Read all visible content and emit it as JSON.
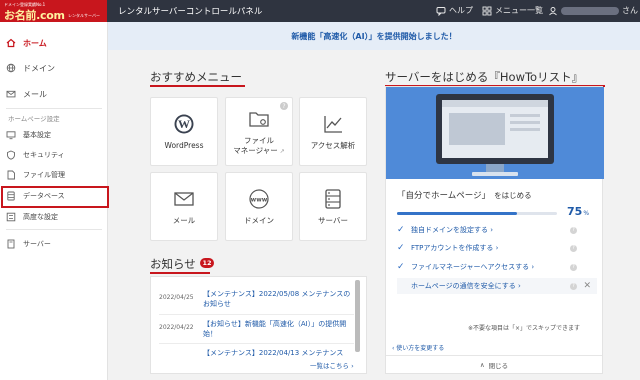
{
  "header": {
    "logo_tagline": "ドメイン登録実績No.1",
    "logo_brand": "お名前.com",
    "logo_sub": "レンタルサーバー",
    "title": "レンタルサーバーコントロールパネル",
    "help_label": "ヘルプ",
    "menu_label": "メニュー一覧",
    "user_suffix": "さん"
  },
  "notice": {
    "text": "新機能「高速化（AI）」を提供開始しました！"
  },
  "sidebar": {
    "home": "ホーム",
    "domain": "ドメイン",
    "mail": "メール",
    "section_label": "ホームページ設定",
    "basic": "基本設定",
    "security": "セキュリティ",
    "file_manager": "ファイル管理",
    "database": "データベース",
    "advanced": "高度な設定",
    "server": "サーバー"
  },
  "recommended": {
    "title": "おすすめメニュー",
    "cards": [
      {
        "label": "WordPress",
        "icon": "wordpress-icon"
      },
      {
        "label": "ファイル",
        "label2": "マネージャー",
        "icon": "folder-gear-icon",
        "help": "?",
        "ext": "↗"
      },
      {
        "label": "アクセス解析",
        "icon": "chart-line-icon"
      },
      {
        "label": "メール",
        "icon": "envelope-icon"
      },
      {
        "label": "ドメイン",
        "icon": "www-globe-icon"
      },
      {
        "label": "サーバー",
        "icon": "server-icon"
      }
    ]
  },
  "news": {
    "title": "お知らせ",
    "count": "12",
    "items": [
      {
        "date": "2022/04/25",
        "text": "【メンテナンス】2022/05/08 メンテナンスのお知らせ"
      },
      {
        "date": "2022/04/22",
        "text": "【お知らせ】新機能「高速化（AI）」の提供開始！"
      },
      {
        "date": "",
        "text": "【メンテナンス】2022/04/13 メンテナンス"
      }
    ],
    "more": "一覧はこちら ›"
  },
  "howto": {
    "title": "サーバーをはじめる『HowToリスト』",
    "goal_main": "「自分でホームページ」",
    "goal_sub": "をはじめる",
    "progress_percent": 75,
    "progress_value": "75",
    "progress_unit": "%",
    "tasks": [
      {
        "label": "独自ドメインを設定する ›",
        "help": "?",
        "done": true
      },
      {
        "label": "FTPアカウントを作成する ›",
        "help": "?",
        "done": true
      },
      {
        "label": "ファイルマネージャーへアクセスする ›",
        "help": "?",
        "done": true
      },
      {
        "label": "ホームページの通信を安全にする ›",
        "help": "?",
        "done": false
      }
    ],
    "note": "※不要な項目は「×」でスキップできます",
    "change": "‹ 使い方を変更する",
    "close": "閉じる"
  },
  "colors": {
    "brand_red": "#c8161d",
    "link_blue": "#1f5aa8",
    "header_dark": "#2f3440"
  }
}
